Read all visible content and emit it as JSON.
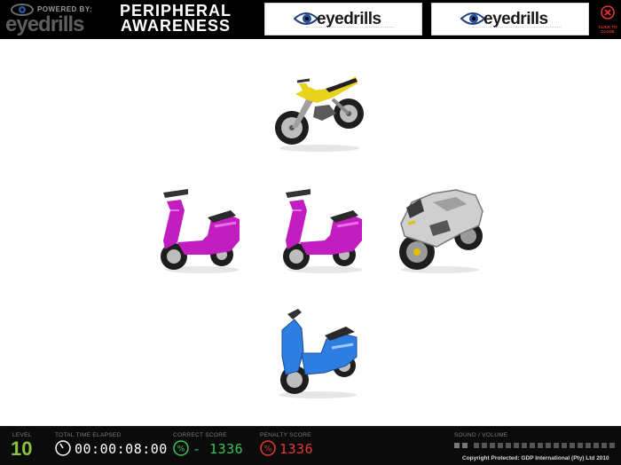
{
  "header": {
    "powered_by": "POWERED BY:",
    "brand": "eyedrills",
    "title_line1": "PERIPHERAL",
    "title_line2": "AWARENESS",
    "sponsor1": "eyedrills",
    "sponsor2": "eyedrills",
    "close_label": "CLICK TO CLOSE"
  },
  "vehicles": [
    {
      "name": "dirt-bike-yellow",
      "color": "#e8d21c"
    },
    {
      "name": "scooter-magenta-left",
      "color": "#c21dc0"
    },
    {
      "name": "scooter-magenta-center",
      "color": "#c21dc0"
    },
    {
      "name": "sport-motorbike-silver",
      "color": "#c8c8c8"
    },
    {
      "name": "scooter-blue",
      "color": "#2d7ee0"
    }
  ],
  "footer": {
    "level_label": "LEVEL",
    "level_value": "10",
    "time_label": "TOTAL TIME ELAPSED",
    "time_value": "00:00:08:00",
    "correct_label": "CORRECT SCORE",
    "correct_value": "- 1336",
    "penalty_label": "PENALTY SCORE",
    "penalty_value": "1336",
    "sound_label": "SOUND / VOLUME",
    "copyright": "Copyright Protected: GDP International (Pty) Ltd 2010"
  },
  "colors": {
    "level": "#8ac43f",
    "correct": "#38c653",
    "penalty": "#e63b32",
    "close": "#e8342f"
  }
}
